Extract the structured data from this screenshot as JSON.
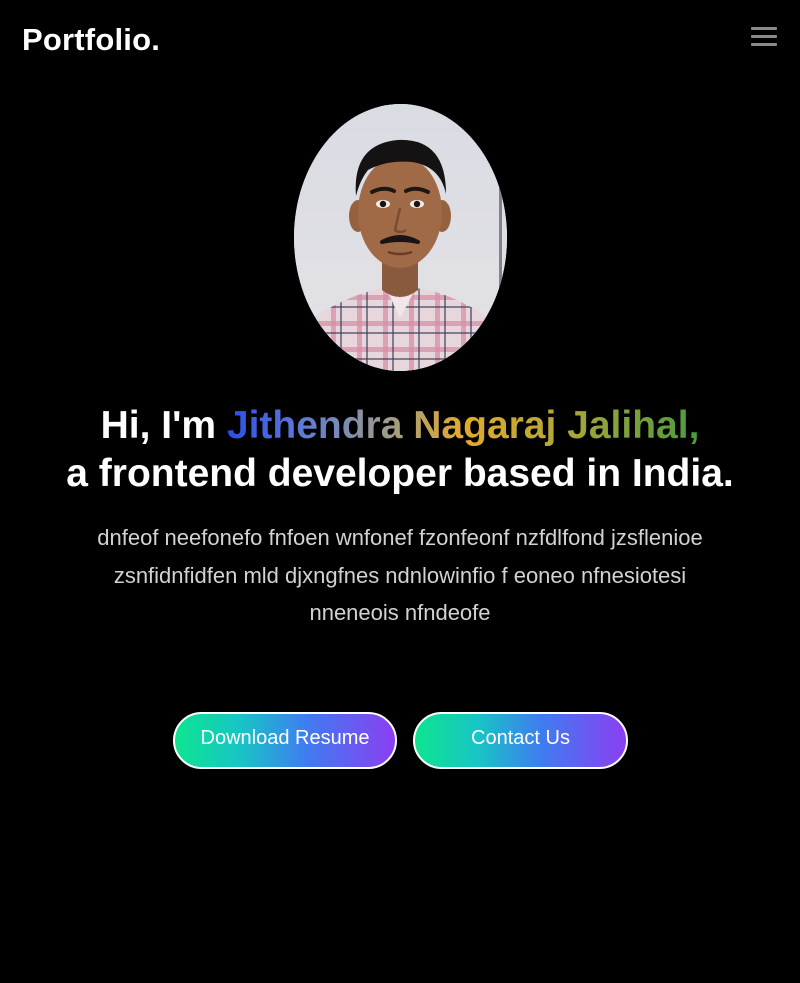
{
  "header": {
    "logo": "Portfolio.",
    "menu_icon": "hamburger-menu-icon"
  },
  "hero": {
    "avatar_alt": "profile photo",
    "greeting": "Hi, I'm",
    "name": "Jithendra Nagaraj Jalihal,",
    "tagline": "a frontend developer based in India.",
    "description_line1": "dnfeof neefonefo fnfoen wnfonef fzonfeonf nzfdlfond jzsflenioe",
    "description_line2": "zsnfidnfidfen mld djxngfnes ndnlowinfio f eoneo nfnesiotesi nneneois nfndeofe"
  },
  "actions": {
    "resume_label": "Download Resume",
    "contact_label": "Contact Us"
  },
  "colors": {
    "background": "#000000",
    "button_gradient_start": "#0de58f",
    "button_gradient_end": "#8b3ef2",
    "name_gradient_start": "#2c4ee6",
    "name_gradient_end": "#4a9a3e"
  }
}
